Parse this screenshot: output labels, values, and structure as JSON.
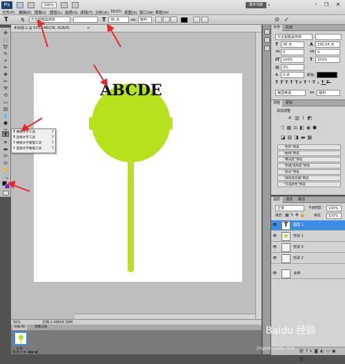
{
  "menubar": {
    "ps_label": "Ps",
    "items": [
      "文件(F)",
      "编辑(E)",
      "图像(I)",
      "图层(L)",
      "选择(S)",
      "滤镜(T)",
      "分析(A)",
      "3D(D)",
      "视图(V)",
      "窗口(W)",
      "帮助(H)"
    ],
    "zoom_value": "100%",
    "workspace_label": "基本功能"
  },
  "options": {
    "font_family": "方正超粗黑简体",
    "font_style": "-",
    "font_size": "36 点",
    "aa_mode": "锐利"
  },
  "document": {
    "tab_title": "未标题-1 @ 50% (ABCDE, RGB/8)",
    "canvas_text": "ABCDE",
    "zoom": "50%",
    "doc_size": "文档:1.49M/6.39M"
  },
  "tool_flyout": {
    "items": [
      {
        "label": "横排文字工具",
        "key": "T"
      },
      {
        "label": "直排文字工具",
        "key": "T"
      },
      {
        "label": "横排文字蒙版工具",
        "key": "T"
      },
      {
        "label": "直排文字蒙版工具",
        "key": "T"
      }
    ]
  },
  "character_panel": {
    "tabs": [
      "字符",
      "段落"
    ],
    "font_family": "方正超粗黑简体",
    "font_size": "36 点",
    "leading": "190.04 点",
    "scale_v": "100%",
    "scale_h": "100%",
    "tracking": "0",
    "kerning": "0%",
    "baseline": "0 点",
    "color_label": "颜色:",
    "language": "美国英语",
    "aa": "锐利"
  },
  "adjustments_panel": {
    "tabs": [
      "调整",
      "蒙版"
    ],
    "title": "添加调整",
    "presets": [
      "\"色阶\"预设",
      "\"曲线\"预设",
      "\"曝光度\"预设",
      "\"色相/饱和度\"预设",
      "\"黑白\"预设",
      "\"通道混合器\"预设",
      "\"可选颜色\"预设"
    ]
  },
  "layers_panel": {
    "tabs": [
      "图层",
      "通道",
      "路径"
    ],
    "blend_mode": "正常",
    "opacity_label": "不透明度:",
    "opacity": "100%",
    "lock_label": "锁定:",
    "fill_label": "填充:",
    "fill": "100%",
    "layers": [
      {
        "name": "图层 1",
        "type": "text",
        "selected": true
      },
      {
        "name": "形状 1",
        "type": "shape",
        "selected": false
      },
      {
        "name": "形状 3",
        "type": "shape",
        "selected": false
      },
      {
        "name": "形状 2",
        "type": "shape",
        "selected": false
      },
      {
        "name": "背景",
        "type": "background",
        "selected": false
      }
    ]
  },
  "bottom_panel": {
    "tabs": [
      "动画(帧)",
      "测量记录"
    ],
    "frame_time": "0 秒"
  },
  "colors": {
    "lollipop": "#b5e21d",
    "arrow": "#e8262a",
    "selection": "#3a8ee6",
    "foreground": "#000000",
    "background": "#ffffff"
  },
  "watermark": {
    "text": "Baidu 经验",
    "url": "jingyan.baidu.com"
  }
}
